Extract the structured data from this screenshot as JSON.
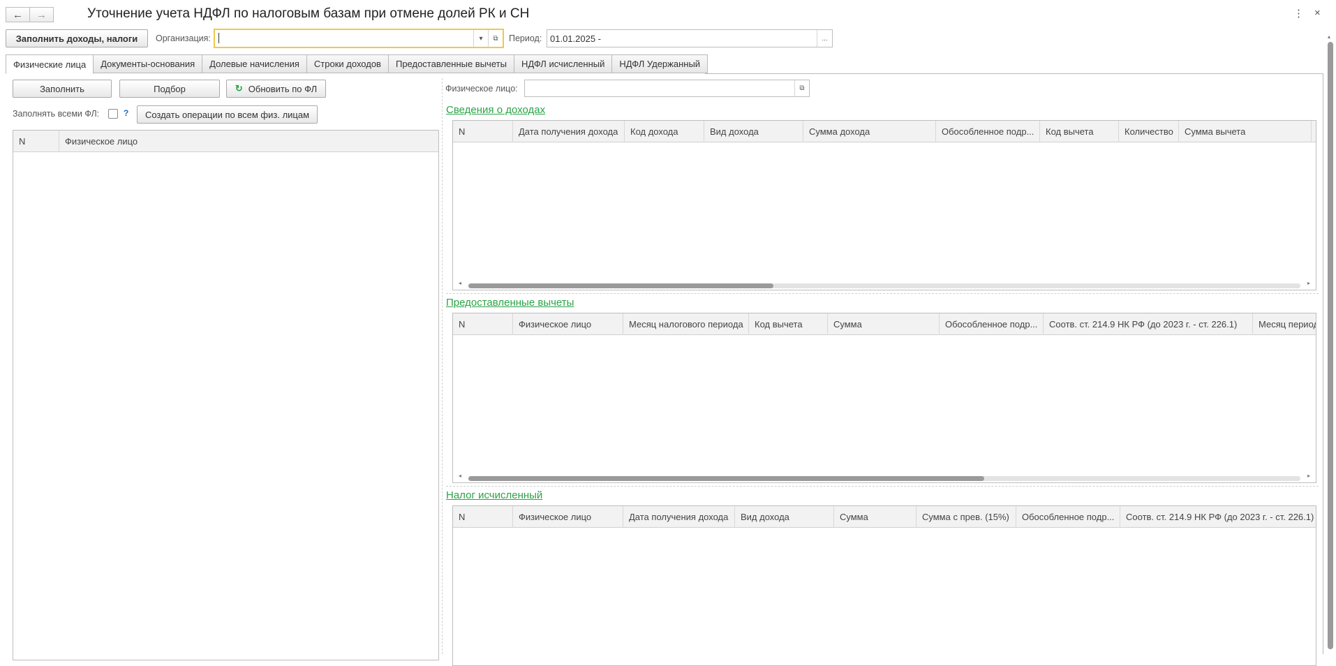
{
  "window": {
    "title": "Уточнение учета НДФЛ по налоговым базам при отмене долей РК и СН",
    "back_icon": "←",
    "forward_icon": "→",
    "more_icon": "⋮",
    "close_icon": "×"
  },
  "toolbar": {
    "fill_incomes_label": "Заполнить доходы, налоги",
    "org_label": "Организация:",
    "org_value": "",
    "period_label": "Период:",
    "period_value": "01.01.2025 -",
    "dropdown_icon": "▾",
    "open_icon": "⧉",
    "ellipsis_icon": "..."
  },
  "tabs": [
    {
      "label": "Физические лица",
      "active": true
    },
    {
      "label": "Документы-основания",
      "active": false
    },
    {
      "label": "Долевые начисления",
      "active": false
    },
    {
      "label": "Строки доходов",
      "active": false
    },
    {
      "label": "Предоставленные вычеты",
      "active": false
    },
    {
      "label": "НДФЛ исчисленный",
      "active": false
    },
    {
      "label": "НДФЛ Удержанный",
      "active": false
    }
  ],
  "left": {
    "fill_label": "Заполнить",
    "select_label": "Подбор",
    "refresh_label": "Обновить по ФЛ",
    "refresh_icon": "↻",
    "fill_all_label": "Заполнять всеми ФЛ:",
    "fill_all_checked": false,
    "help_label": "?",
    "create_ops_label": "Создать операции по всем физ. лицам",
    "grid_columns": [
      "N",
      "Физическое лицо"
    ],
    "rows": []
  },
  "right": {
    "person_label": "Физическое лицо:",
    "person_value": "",
    "incomes": {
      "title": "Сведения о доходах",
      "columns": [
        "N",
        "Дата получения дохода",
        "Код дохода",
        "Вид дохода",
        "Сумма дохода",
        "Обособленное подр...",
        "Код вычета",
        "Количество",
        "Сумма вычета"
      ],
      "rows": []
    },
    "deductions": {
      "title": "Предоставленные вычеты",
      "columns": [
        "N",
        "Физическое лицо",
        "Месяц налогового периода",
        "Код вычета",
        "Сумма",
        "Обособленное подр...",
        "Соотв. ст. 214.9 НК РФ (до 2023 г. - ст. 226.1)",
        "Месяц периода"
      ],
      "rows": []
    },
    "tax": {
      "title": "Налог исчисленный",
      "columns": [
        "N",
        "Физическое лицо",
        "Дата получения дохода",
        "Вид дохода",
        "Сумма",
        "Сумма с прев. (15%)",
        "Обособленное подр...",
        "Соотв. ст. 214.9 НК РФ (до 2023 г. - ст. 226.1)"
      ],
      "rows": []
    }
  },
  "colors": {
    "accent_green": "#2aa346",
    "active_field_border": "#f0c84a",
    "help_blue": "#1f6fbf"
  }
}
